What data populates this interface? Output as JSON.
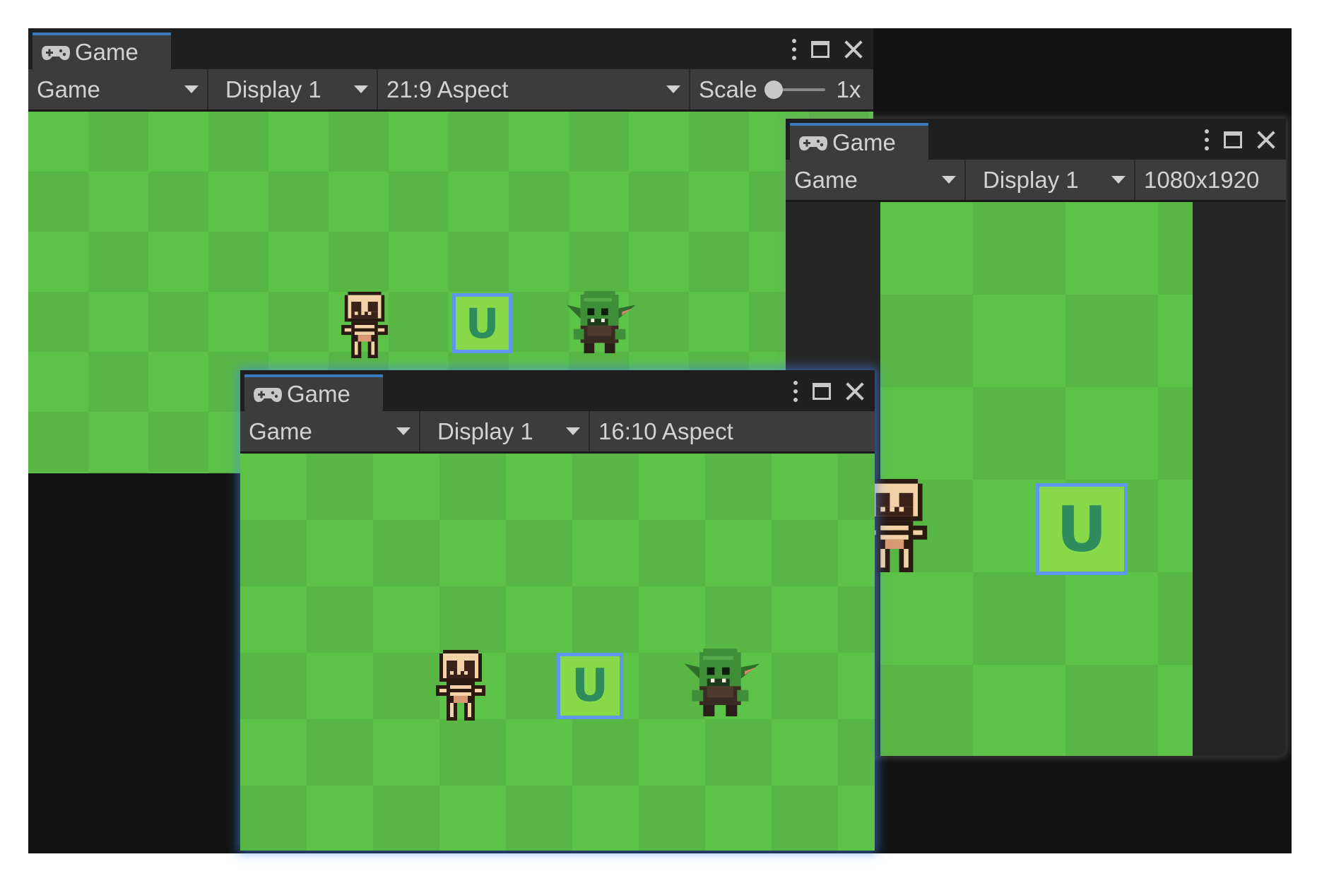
{
  "colors": {
    "tab_accent": "#3a79bb",
    "focus_glow": "#468cff",
    "scene_green_light": "#5cc248",
    "scene_green_dark": "#57b644",
    "ui_block_fill": "#87d94a",
    "ui_block_border": "#5f97f0",
    "ui_letter": "#2e8b5b"
  },
  "windows": {
    "top_left": {
      "tab_label": "Game",
      "tab_icon": "gamepad-icon",
      "view_mode": "Game",
      "display": "Display 1",
      "aspect": "21:9 Aspect",
      "scale_label": "Scale",
      "scale_value": "1x",
      "block_letter": "U"
    },
    "right": {
      "tab_label": "Game",
      "tab_icon": "gamepad-icon",
      "view_mode": "Game",
      "display": "Display 1",
      "resolution": "1080x1920",
      "block_letter": "U"
    },
    "front": {
      "tab_label": "Game",
      "tab_icon": "gamepad-icon",
      "view_mode": "Game",
      "display": "Display 1",
      "aspect": "16:10 Aspect",
      "block_letter": "U"
    }
  }
}
